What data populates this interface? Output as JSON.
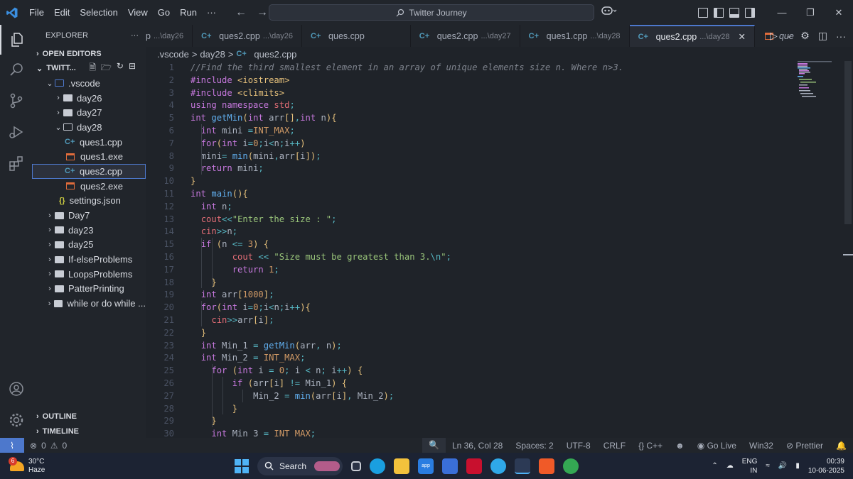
{
  "titlebar": {
    "menu": [
      "File",
      "Edit",
      "Selection",
      "View",
      "Go",
      "Run",
      "···"
    ],
    "command_center": "Twitter Journey"
  },
  "sidebar": {
    "title": "EXPLORER",
    "more": "···",
    "open_editors": "OPEN EDITORS",
    "workspace": "TWITT...",
    "tree": [
      {
        "label": ".vscode",
        "kind": "root-open"
      },
      {
        "label": "day26",
        "kind": "folder"
      },
      {
        "label": "day27",
        "kind": "folder"
      },
      {
        "label": "day28",
        "kind": "folder-open"
      },
      {
        "label": "ques1.cpp",
        "kind": "cpp"
      },
      {
        "label": "ques1.exe",
        "kind": "exe"
      },
      {
        "label": "ques2.cpp",
        "kind": "cpp"
      },
      {
        "label": "ques2.exe",
        "kind": "exe"
      },
      {
        "label": "settings.json",
        "kind": "json"
      },
      {
        "label": "Day7",
        "kind": "folder"
      },
      {
        "label": "day23",
        "kind": "folder"
      },
      {
        "label": "day25",
        "kind": "folder"
      },
      {
        "label": "If-elseProblems",
        "kind": "folder"
      },
      {
        "label": "LoopsProblems",
        "kind": "folder"
      },
      {
        "label": "PatterPrinting",
        "kind": "folder"
      },
      {
        "label": "while or do while ...",
        "kind": "folder"
      }
    ],
    "outline": "OUTLINE",
    "timeline": "TIMELINE"
  },
  "tabs": [
    {
      "name": "p",
      "dir": "...\\day26"
    },
    {
      "name": "ques2.cpp",
      "dir": "...\\day26"
    },
    {
      "name": "ques.cpp",
      "dir": ""
    },
    {
      "name": "ques2.cpp",
      "dir": "...\\day27"
    },
    {
      "name": "ques1.cpp",
      "dir": "...\\day28"
    },
    {
      "name": "ques2.cpp",
      "dir": "...\\day28"
    },
    {
      "name": "que",
      "dir": ""
    }
  ],
  "breadcrumb": {
    "part1": ".vscode",
    "part2": "day28",
    "part3": "ques2.cpp",
    "sep": ">"
  },
  "code": [
    "//Find the third smallest element in an array of unique elements size n. Where n>3.",
    "#include <iostream>",
    "#include <climits>",
    "using namespace std;",
    "int getMin(int arr[],int n){",
    "  int mini =INT_MAX;",
    "  for(int i=0;i<n;i++)",
    "  mini= min(mini,arr[i]);",
    "  return mini;",
    "}",
    "int main(){",
    "  int n;",
    "  cout<<\"Enter the size : \";",
    "  cin>>n;",
    "  if (n <= 3) {",
    "        cout << \"Size must be greatest than 3.\\n\";",
    "        return 1;",
    "    }",
    "  int arr[1000];",
    "  for(int i=0;i<n;i++){",
    "    cin>>arr[i];",
    "  }",
    "  int Min_1 = getMin(arr, n);",
    "  int Min_2 = INT_MAX;",
    "    for (int i = 0; i < n; i++) {",
    "        if (arr[i] != Min_1) {",
    "            Min_2 = min(arr[i], Min_2);",
    "        }",
    "    }",
    "    int Min_3 = INT_MAX;"
  ],
  "statusbar": {
    "errors": "0",
    "warnings": "0",
    "position": "Ln 36, Col 28",
    "spaces": "Spaces: 2",
    "encoding": "UTF-8",
    "eol": "CRLF",
    "language": "C++",
    "golive": "Go Live",
    "platform": "Win32",
    "prettier": "Prettier"
  },
  "taskbar": {
    "temp": "30°C",
    "weather": "Haze",
    "badge": "6",
    "search": "Search",
    "lang1": "ENG",
    "lang2": "IN",
    "time": "00:39",
    "date": "10-06-2025"
  },
  "colors": {
    "accent": "#4d78cc",
    "keyword": "#c678dd",
    "function": "#61afef",
    "string": "#98c379",
    "number": "#d19a66"
  }
}
